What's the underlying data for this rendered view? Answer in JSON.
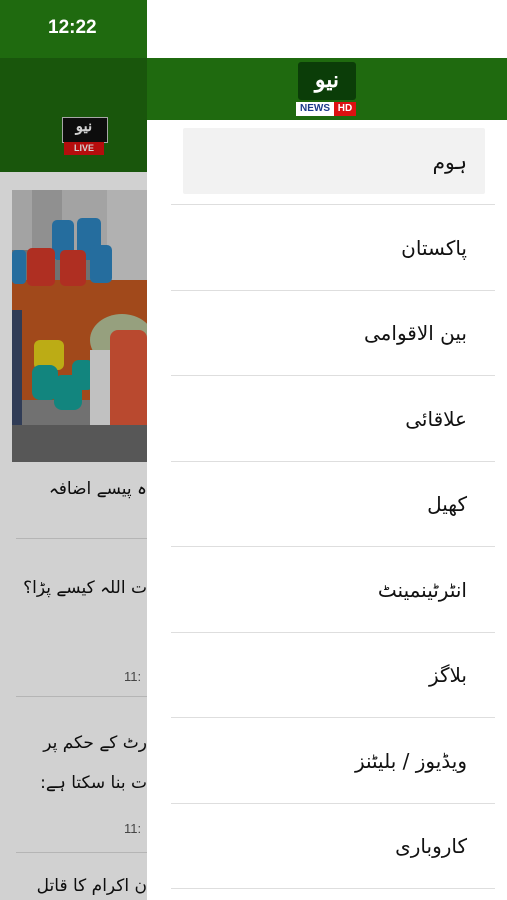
{
  "status_bar": {
    "time": "12:22"
  },
  "background_page": {
    "logo_text": "نیو",
    "logo_live": "LIVE",
    "headline_1": "ہ پیسے اضافہ",
    "headline_2": "ت اللہ کیسے پڑا؟",
    "time_1": "11:",
    "headline_3_line1": "رٹ کے حکم پر",
    "headline_3_line2": "ت بنا سکتا ہے:",
    "time_2": "11:",
    "headline_4": "ن اکرام کا قاتل"
  },
  "drawer": {
    "logo_text": "نیو",
    "logo_news": "NEWS",
    "logo_hd": "HD",
    "menu": [
      {
        "label": "ہوم"
      },
      {
        "label": "پاکستان"
      },
      {
        "label": "بین الاقوامی"
      },
      {
        "label": "علاقائی"
      },
      {
        "label": "کھیل"
      },
      {
        "label": "انٹرٹینمینٹ"
      },
      {
        "label": "بلاگز"
      },
      {
        "label": "ویڈیوز / بلیٹنز"
      },
      {
        "label": "کاروباری"
      }
    ]
  },
  "colors": {
    "brand_green": "#1f6a0f",
    "active_item_bg": "#f2f2f2"
  }
}
